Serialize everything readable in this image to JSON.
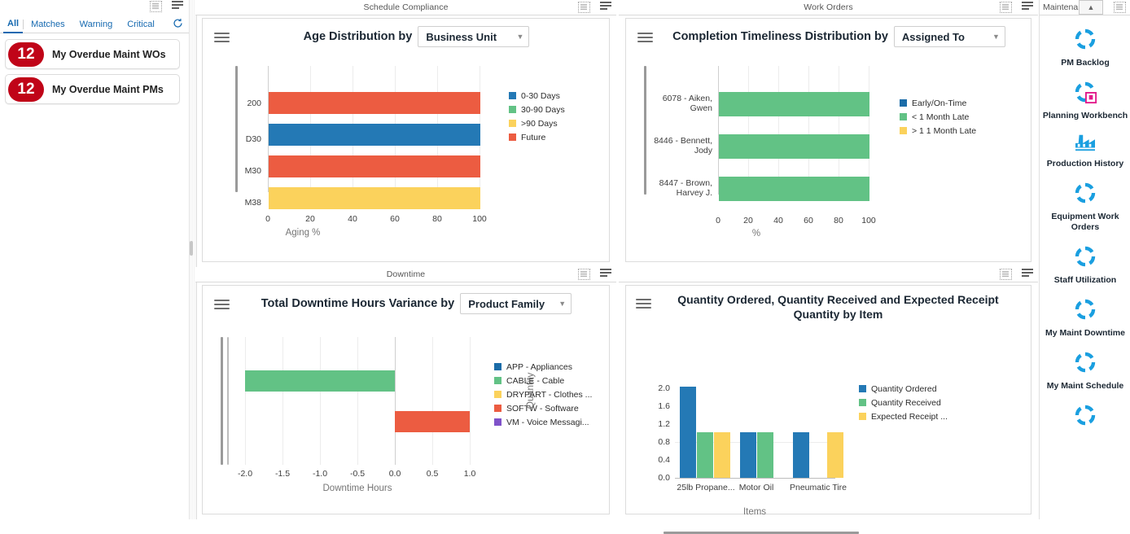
{
  "left_panel": {
    "tabs": [
      {
        "label": "All",
        "active": true
      },
      {
        "label": "Matches",
        "active": false
      },
      {
        "label": "Warning",
        "active": false
      },
      {
        "label": "Critical",
        "active": false
      }
    ],
    "refresh_icon": "refresh-icon",
    "alerts": [
      {
        "count": "12",
        "label": "My Overdue Maint WOs"
      },
      {
        "count": "12",
        "label": "My Overdue Maint PMs"
      }
    ]
  },
  "panels": [
    {
      "title": "Schedule Compliance"
    },
    {
      "title": "Work Orders"
    },
    {
      "title": "Downtime"
    },
    {
      "title": ""
    }
  ],
  "right_sidebar": {
    "title": "Maintenance ...",
    "collapse_icon": "chevron-up-icon",
    "expand_icon": "expand-icon",
    "tiles": [
      {
        "label": "PM Backlog",
        "icon": "refresh-circle-icon"
      },
      {
        "label": "Planning Workbench",
        "icon": "refresh-circle-calendar-icon"
      },
      {
        "label": "Production History",
        "icon": "factory-icon"
      },
      {
        "label": "Equipment Work Orders",
        "icon": "refresh-circle-icon"
      },
      {
        "label": "Staff Utilization",
        "icon": "refresh-circle-icon"
      },
      {
        "label": "My Maint Downtime",
        "icon": "refresh-circle-icon"
      },
      {
        "label": "My Maint Schedule",
        "icon": "refresh-circle-icon"
      },
      {
        "label": "",
        "icon": "refresh-circle-icon"
      }
    ]
  },
  "colors": {
    "blue": "#2479b5",
    "green": "#62c285",
    "yellow": "#fbd25c",
    "orange": "#ec5c41",
    "purple": "#7f52c9",
    "badge_red": "#c00418",
    "link_blue": "#1569b0",
    "tile_blue": "#1a9fe0",
    "tile_pink": "#e2198b"
  },
  "chart_data": [
    {
      "id": "age-distribution",
      "type": "bar",
      "orientation": "horizontal",
      "panel": "Schedule Compliance",
      "title_prefix": "Age Distribution by",
      "selector_value": "Business Unit",
      "menu_icon": "hamburger-icon",
      "categories": [
        "200",
        "D30",
        "M30",
        "M38"
      ],
      "bar_series": [
        "Future",
        "0-30 Days",
        "Future",
        ">90 Days"
      ],
      "values": [
        100,
        100,
        100,
        100
      ],
      "xlabel": "Aging %",
      "ylabel": "",
      "xticks": [
        "0",
        "20",
        "40",
        "60",
        "80",
        "100"
      ],
      "xlim": [
        0,
        100
      ],
      "grid": true,
      "legend_position": "right",
      "legend": [
        {
          "label": "0-30 Days",
          "color": "#2479b5"
        },
        {
          "label": "30-90 Days",
          "color": "#62c285"
        },
        {
          "label": ">90 Days",
          "color": "#fbd25c"
        },
        {
          "label": "Future",
          "color": "#ec5c41"
        }
      ]
    },
    {
      "id": "completion-timeliness",
      "type": "bar",
      "orientation": "horizontal",
      "panel": "Work Orders",
      "title_prefix": "Completion Timeliness Distribution by",
      "selector_value": "Assigned To",
      "menu_icon": "hamburger-icon",
      "categories": [
        "6078 - Aiken, Gwen",
        "8446 - Bennett, Jody",
        "8447 - Brown, Harvey J."
      ],
      "bar_series": [
        "< 1 Month Late",
        "< 1 Month Late",
        "< 1 Month Late"
      ],
      "values": [
        100,
        100,
        100
      ],
      "xlabel": "%",
      "ylabel": "",
      "xticks": [
        "0",
        "20",
        "40",
        "60",
        "80",
        "100"
      ],
      "xlim": [
        0,
        100
      ],
      "grid": true,
      "legend_position": "right",
      "legend": [
        {
          "label": "Early/On-Time",
          "color": "#1b6ca8"
        },
        {
          "label": "< 1 Month Late",
          "color": "#62c285"
        },
        {
          "label": "> 1 1 Month Late",
          "color": "#fbd25c"
        }
      ]
    },
    {
      "id": "downtime-variance",
      "type": "bar",
      "orientation": "horizontal",
      "panel": "Downtime",
      "title_prefix": "Total Downtime Hours Variance by",
      "selector_value": "Product Family",
      "menu_icon": "hamburger-icon",
      "categories": [
        "CABLE - Cable",
        "SOFTW - Software"
      ],
      "values": [
        -2.0,
        1.0
      ],
      "bar_colors": [
        "#62c285",
        "#ec5c41"
      ],
      "xlabel": "Downtime Hours",
      "ylabel": "",
      "xticks": [
        "-2.0",
        "-1.5",
        "-1.0",
        "-0.5",
        "0.0",
        "0.5",
        "1.0"
      ],
      "xlim": [
        -2.0,
        1.0
      ],
      "grid": true,
      "legend_position": "right",
      "legend": [
        {
          "label": "APP - Appliances",
          "color": "#1b6ca8"
        },
        {
          "label": "CABLE - Cable",
          "color": "#62c285"
        },
        {
          "label": "DRYPART - Clothes ...",
          "color": "#fbd25c"
        },
        {
          "label": "SOFTW - Software",
          "color": "#ec5c41"
        },
        {
          "label": "VM - Voice Messagi...",
          "color": "#7f52c9"
        }
      ]
    },
    {
      "id": "quantity-by-item",
      "type": "bar",
      "orientation": "vertical",
      "panel": "",
      "title_prefix": "Quantity Ordered, Quantity Received and Expected Receipt Quantity by Item",
      "selector_value": "",
      "menu_icon": "hamburger-icon",
      "categories": [
        "25lb Propane...",
        "Motor Oil",
        "Pneumatic Tire"
      ],
      "series": [
        {
          "name": "Quantity Ordered",
          "color": "#2479b5",
          "values": [
            2.0,
            1.0,
            1.0
          ]
        },
        {
          "name": "Quantity Received",
          "color": "#62c285",
          "values": [
            1.0,
            1.0,
            null
          ]
        },
        {
          "name": "Expected Receipt ...",
          "color": "#fbd25c",
          "values": [
            1.0,
            null,
            1.0
          ]
        }
      ],
      "xlabel": "Items",
      "ylabel": "Quantity",
      "yticks": [
        "2.0",
        "1.6",
        "1.2",
        "0.8",
        "0.4",
        "0.0"
      ],
      "ylim": [
        0,
        2.0
      ],
      "grid": true,
      "legend_position": "right",
      "legend": [
        {
          "label": "Quantity Ordered",
          "color": "#2479b5"
        },
        {
          "label": "Quantity Received",
          "color": "#62c285"
        },
        {
          "label": "Expected Receipt ...",
          "color": "#fbd25c"
        }
      ]
    }
  ]
}
